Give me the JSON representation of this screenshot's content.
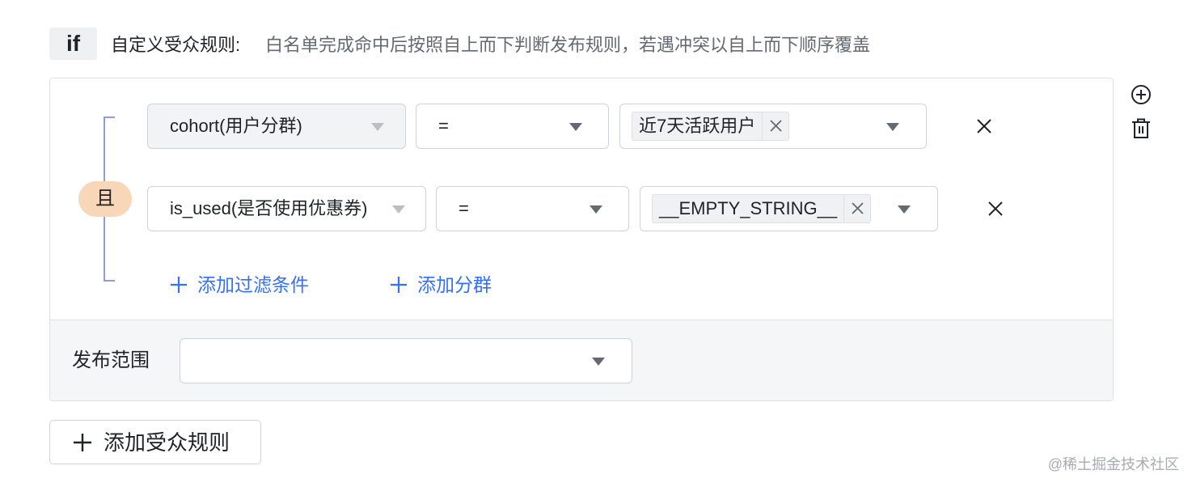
{
  "header": {
    "if_label": "if",
    "title": "自定义受众规则:",
    "description": "白名单完成命中后按照自上而下判断发布规则，若遇冲突以自上而下顺序覆盖"
  },
  "group": {
    "logic_label": "且"
  },
  "conditions": [
    {
      "field": "cohort(用户分群)",
      "operator": "=",
      "value_tag": "近7天活跃用户"
    },
    {
      "field": "is_used(是否使用优惠券)",
      "operator": "=",
      "value_tag": "__EMPTY_STRING__"
    }
  ],
  "actions": {
    "add_filter": "添加过滤条件",
    "add_cohort": "添加分群"
  },
  "scope": {
    "label": "发布范围",
    "value": ""
  },
  "add_rule_label": "添加受众规则",
  "watermark": "@稀土掘金技术社区",
  "icons": {
    "add_circle": "plus-circle-icon",
    "delete": "trash-icon",
    "close": "close-icon",
    "dropdown": "caret-down-icon",
    "plus": "plus-icon"
  },
  "colors": {
    "accent": "#3370ff",
    "and_badge": "#f8d6b8",
    "bracket": "#8f9ecf"
  }
}
